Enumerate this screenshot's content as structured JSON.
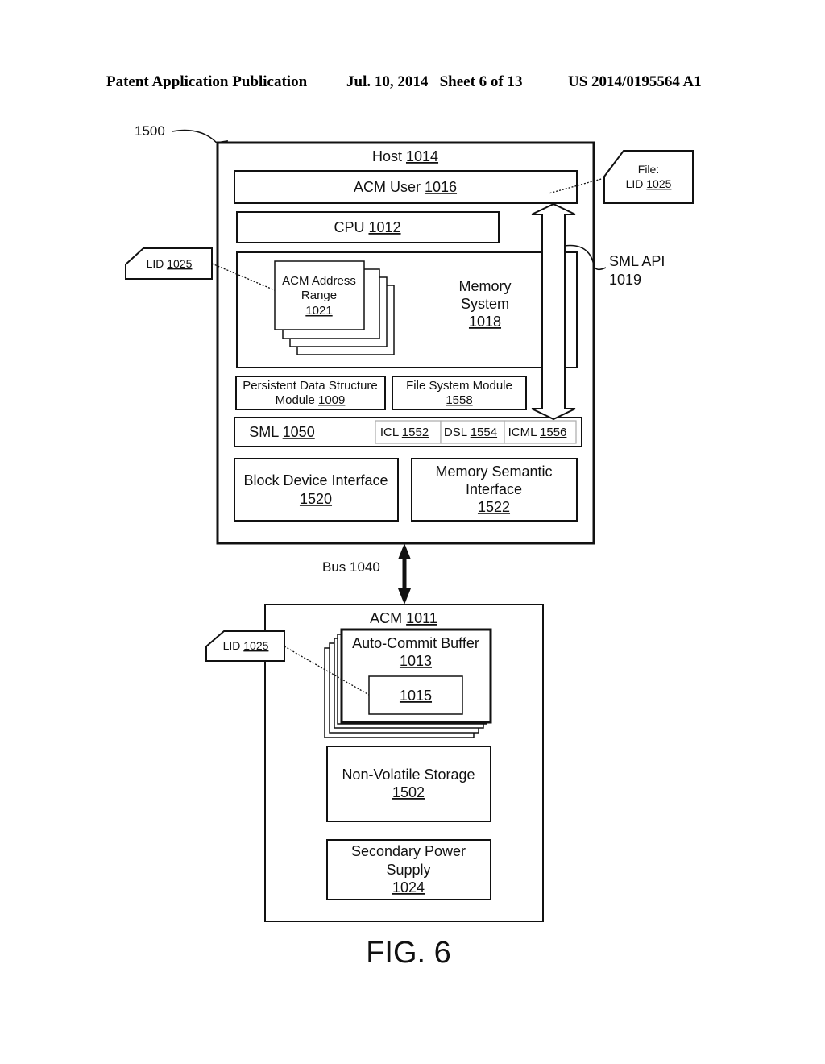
{
  "header": {
    "left": "Patent Application Publication",
    "middle": "Jul. 10, 2014   Sheet 6 of 13",
    "right": "US 2014/0195564 A1"
  },
  "figure": {
    "ref": "1500",
    "caption": "FIG. 6",
    "host": {
      "label": "Host",
      "num": "1014"
    },
    "acm_user": {
      "label": "ACM User",
      "num": "1016"
    },
    "cpu": {
      "label": "CPU",
      "num": "1012"
    },
    "memory_system": {
      "line1": "Memory",
      "line2": "System",
      "num": "1018"
    },
    "acm_address_range": {
      "line1": "ACM Address",
      "line2": "Range",
      "num": "1021"
    },
    "pds_module": {
      "line1": "Persistent Data Structure",
      "line2": "Module",
      "num": "1009"
    },
    "fs_module": {
      "line1": "File System Module",
      "num": "1558"
    },
    "sml": {
      "label": "SML",
      "num": "1050"
    },
    "icl": {
      "label": "ICL",
      "num": "1552"
    },
    "dsl": {
      "label": "DSL",
      "num": "1554"
    },
    "icml": {
      "label": "ICML",
      "num": "1556"
    },
    "block_device": {
      "line1": "Block Device Interface",
      "num": "1520"
    },
    "mem_semantic": {
      "line1": "Memory Semantic",
      "line2": "Interface",
      "num": "1522"
    },
    "sml_api": {
      "line1": "SML API",
      "line2": "1019"
    },
    "file_tag": {
      "line1": "File:",
      "label": "LID",
      "num": "1025"
    },
    "lid_tag_host": {
      "label": "LID",
      "num": "1025"
    },
    "lid_tag_acm": {
      "label": "LID",
      "num": "1025"
    },
    "bus": {
      "label": "Bus 1040"
    },
    "acm": {
      "label": "ACM",
      "num": "1011"
    },
    "acb": {
      "line1": "Auto-Commit Buffer",
      "num": "1013"
    },
    "acb_inner": {
      "num": "1015"
    },
    "nvs": {
      "line1": "Non-Volatile Storage",
      "num": "1502"
    },
    "sps": {
      "line1": "Secondary Power",
      "line2": "Supply",
      "num": "1024"
    }
  }
}
